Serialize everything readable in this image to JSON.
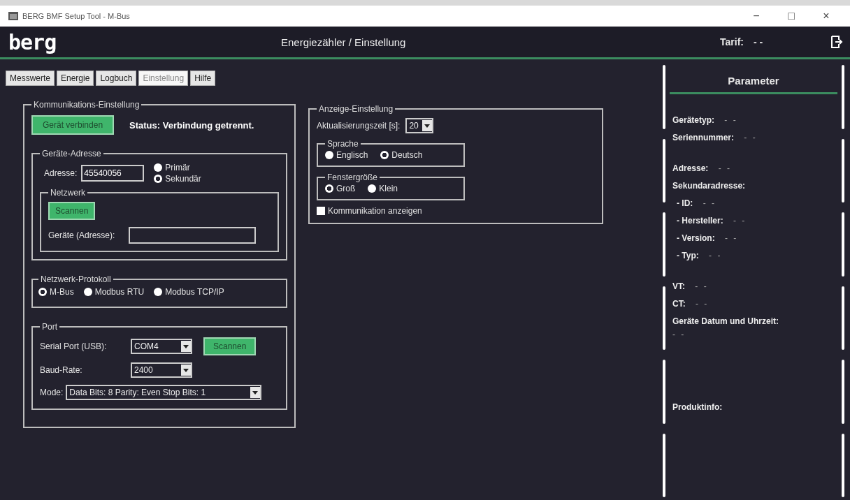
{
  "window": {
    "title": "BERG BMF Setup Tool - M-Bus",
    "controls": [
      "−",
      "□",
      "×"
    ]
  },
  "header": {
    "logo": "berg",
    "title": "Energiezähler / Einstellung",
    "tariff_label": "Tarif:",
    "tariff_value": "- -"
  },
  "tabs": [
    {
      "label": "Messwerte",
      "selected": false
    },
    {
      "label": "Energie",
      "selected": false
    },
    {
      "label": "Logbuch",
      "selected": false
    },
    {
      "label": "Einstellung",
      "selected": true
    },
    {
      "label": "Hilfe",
      "selected": false
    }
  ],
  "communication": {
    "title": "Kommunikations-Einstellung",
    "connect_button": "Gerät verbinden",
    "status": "Status: Verbindung getrennt.",
    "address_group": {
      "title": "Geräte-Adresse",
      "label": "Adresse:",
      "value": "45540056",
      "modes": [
        {
          "label": "Primär",
          "selected": false
        },
        {
          "label": "Sekundär",
          "selected": true
        }
      ],
      "network": {
        "title": "Netzwerk",
        "scan_button": "Scannen",
        "devices_label": "Geräte (Adresse):"
      }
    },
    "protocol": {
      "title": "Netzwerk-Protokoll",
      "options": [
        {
          "label": "M-Bus",
          "selected": true
        },
        {
          "label": "Modbus RTU",
          "selected": false
        },
        {
          "label": "Modbus TCP/IP",
          "selected": false
        }
      ]
    },
    "port": {
      "title": "Port",
      "fields": [
        {
          "label": "Serial Port (USB):",
          "value": "COM4"
        },
        {
          "label": "Baud-Rate:",
          "value": "2400"
        }
      ],
      "scan_button": "Scannen",
      "mode_label": "Mode:",
      "mode_value": "Data Bits: 8  Parity: Even  Stop Bits: 1"
    }
  },
  "display": {
    "title": "Anzeige-Einstellung",
    "refresh_label": "Aktualisierungszeit [s]:",
    "refresh_value": "20",
    "language": {
      "title": "Sprache",
      "options": [
        {
          "label": "Englisch",
          "selected": false
        },
        {
          "label": "Deutsch",
          "selected": true
        }
      ]
    },
    "window_size": {
      "title": "Fenstergröße",
      "options": [
        {
          "label": "Groß",
          "selected": true
        },
        {
          "label": "Klein",
          "selected": false
        }
      ]
    },
    "show_communication": {
      "label": "Kommunikation anzeigen",
      "checked": false
    }
  },
  "parameters": {
    "title": "Parameter",
    "sections": [
      [
        {
          "kind": "pair",
          "text": "**Gerätetyp:** - -"
        },
        {
          "kind": "pair",
          "text": "**Seriennummer:** - -"
        }
      ],
      [
        {
          "kind": "pair",
          "text": "**Adresse:** - -"
        },
        {
          "kind": "pair",
          "text": "**Sekundaradresse:**"
        },
        {
          "kind": "sub",
          "text": "**- ID:** - -"
        },
        {
          "kind": "sub",
          "text": "**- Hersteller:** - -"
        },
        {
          "kind": "sub",
          "text": "**- Version:** - -"
        },
        {
          "kind": "sub",
          "text": "**- Typ:** - -"
        }
      ],
      [
        {
          "kind": "pair",
          "text": "**VT:** - -"
        },
        {
          "kind": "pair",
          "text": "**CT:** - -"
        },
        {
          "kind": "pair",
          "text": "**Geräte Datum und Uhrzeit:**"
        },
        {
          "kind": "note",
          "text": "- -"
        }
      ],
      [
        {
          "kind": "pair",
          "text": "**Produktinfo:**"
        }
      ]
    ]
  }
}
